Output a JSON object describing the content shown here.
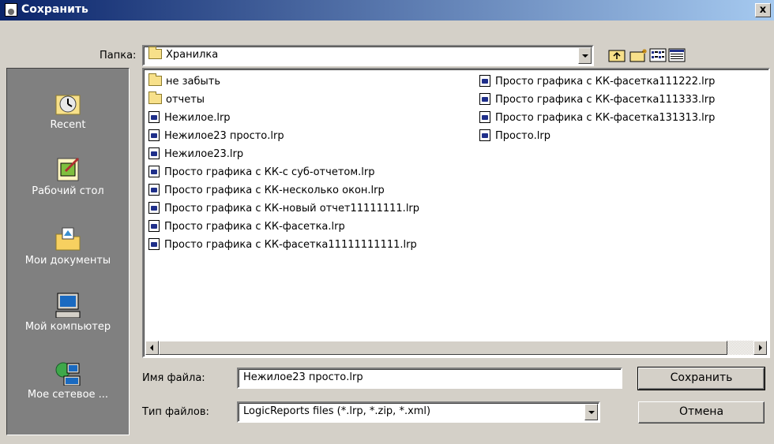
{
  "window": {
    "title": "Сохранить",
    "close_label": "x"
  },
  "folder_bar": {
    "label": "Папка:",
    "current": "Хранилка"
  },
  "places": [
    {
      "label": "Recent",
      "icon": "recent-clock-icon"
    },
    {
      "label": "Рабочий стол",
      "icon": "desktop-icon"
    },
    {
      "label": "Мои документы",
      "icon": "my-documents-icon"
    },
    {
      "label": "Мой компьютер",
      "icon": "my-computer-icon"
    },
    {
      "label": "Мое сетевое ...",
      "icon": "network-icon"
    }
  ],
  "files": {
    "col1": [
      {
        "name": "не забыть",
        "type": "folder"
      },
      {
        "name": "отчеты",
        "type": "folder"
      },
      {
        "name": "Нежилое.lrp",
        "type": "file"
      },
      {
        "name": "Нежилое23 просто.lrp",
        "type": "file"
      },
      {
        "name": "Нежилое23.lrp",
        "type": "file"
      },
      {
        "name": "Просто графика с КК-с суб-отчетом.lrp",
        "type": "file"
      },
      {
        "name": "Просто графика с КК-несколько окон.lrp",
        "type": "file"
      },
      {
        "name": "Просто графика с КК-новый отчет11111111.lrp",
        "type": "file"
      },
      {
        "name": "Просто графика с КК-фасетка.lrp",
        "type": "file"
      },
      {
        "name": "Просто графика с КК-фасетка11111111111.lrp",
        "type": "file"
      }
    ],
    "col2": [
      {
        "name": "Просто графика с КК-фасетка111222.lrp",
        "type": "file"
      },
      {
        "name": "Просто графика с КК-фасетка111333.lrp",
        "type": "file"
      },
      {
        "name": "Просто графика с КК-фасетка131313.lrp",
        "type": "file"
      },
      {
        "name": "Просто.lrp",
        "type": "file"
      }
    ]
  },
  "filename": {
    "label": "Имя файла:",
    "value": "Нежилое23 просто.lrp"
  },
  "filetype": {
    "label": "Тип файлов:",
    "value": "LogicReports files (*.lrp, *.zip, *.xml)"
  },
  "buttons": {
    "save": "Сохранить",
    "cancel": "Отмена"
  }
}
